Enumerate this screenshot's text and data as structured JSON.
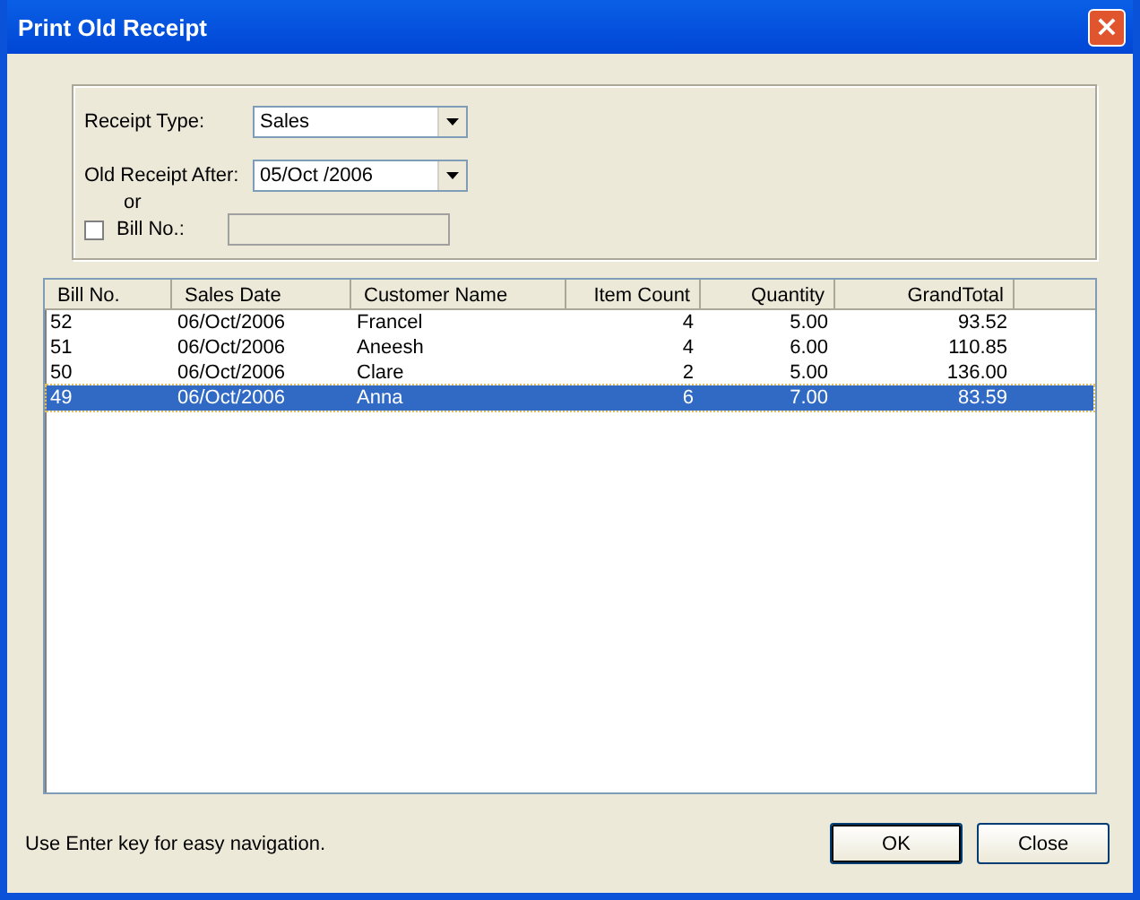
{
  "window": {
    "title": "Print Old Receipt",
    "close": "×"
  },
  "filters": {
    "receipt_type": {
      "label": "Receipt Type:",
      "value": "Sales"
    },
    "after": {
      "label": "Old Receipt After:",
      "value": "05/Oct /2006"
    },
    "or_label": "or",
    "bill_no": {
      "label": "Bill No.:",
      "checked": false
    }
  },
  "table": {
    "columns": [
      {
        "label": "Bill No.",
        "kind": "text"
      },
      {
        "label": "Sales Date",
        "kind": "text"
      },
      {
        "label": "Customer Name",
        "kind": "text"
      },
      {
        "label": "Item Count",
        "kind": "number"
      },
      {
        "label": "Quantity",
        "kind": "number"
      },
      {
        "label": "GrandTotal",
        "kind": "number"
      }
    ],
    "rows": [
      {
        "cells": [
          "52",
          "06/Oct/2006",
          "Francel",
          "4",
          "5.00",
          "93.52"
        ],
        "selected": false
      },
      {
        "cells": [
          "51",
          "06/Oct/2006",
          "Aneesh",
          "4",
          "6.00",
          "110.85"
        ],
        "selected": false
      },
      {
        "cells": [
          "50",
          "06/Oct/2006",
          "Clare",
          "2",
          "5.00",
          "136.00"
        ],
        "selected": false
      },
      {
        "cells": [
          "49",
          "06/Oct/2006",
          "Anna",
          "6",
          "7.00",
          "83.59"
        ],
        "selected": true
      }
    ]
  },
  "hint": "Use Enter key for easy navigation.",
  "buttons": [
    {
      "label": "OK",
      "default": true
    },
    {
      "label": "Close",
      "default": false
    }
  ]
}
